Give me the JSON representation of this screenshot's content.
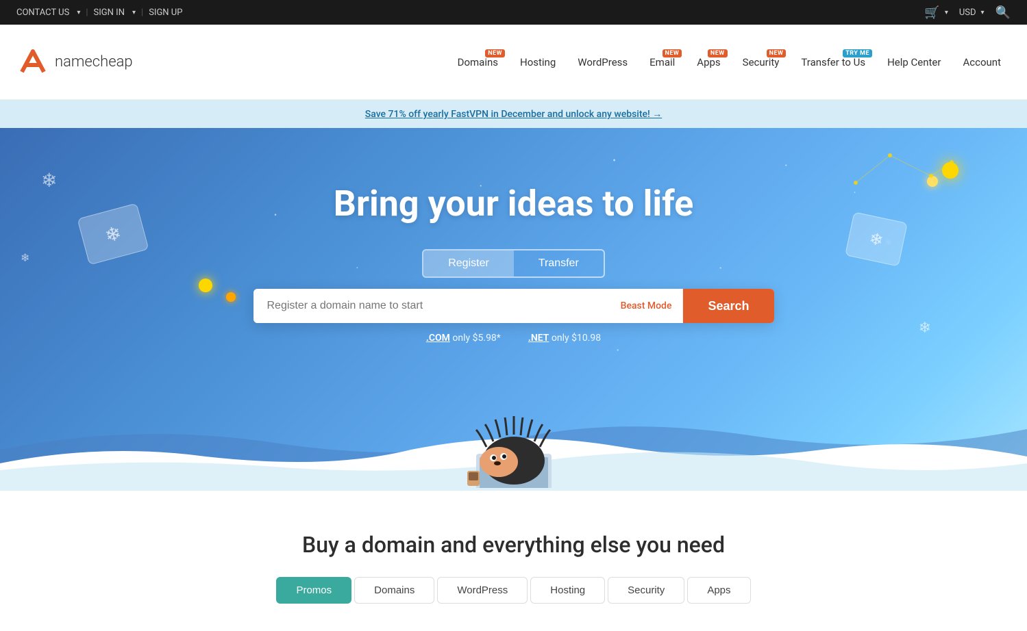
{
  "topbar": {
    "contact_us": "CONTACT US",
    "sign_in": "SIGN IN",
    "sign_up": "SIGN UP",
    "currency": "USD"
  },
  "nav": {
    "logo_text": "namecheap",
    "domains": "Domains",
    "hosting": "Hosting",
    "wordpress": "WordPress",
    "email": "Email",
    "apps": "Apps",
    "security": "Security",
    "transfer": "Transfer to Us",
    "help_center": "Help Center",
    "account": "Account",
    "badge_new": "NEW",
    "badge_tryme": "TRY ME"
  },
  "promo": {
    "text": "Save 71% off yearly FastVPN in December and unlock any website! →"
  },
  "hero": {
    "title": "Bring your ideas to life",
    "tab_register": "Register",
    "tab_transfer": "Transfer",
    "search_placeholder": "Register a domain name to start",
    "beast_mode": "Beast Mode",
    "search_btn": "Search",
    "com_label": ".COM",
    "com_price": "only $5.98*",
    "net_label": ".NET",
    "net_price": "only $10.98"
  },
  "below": {
    "title": "Buy a domain and everything else you need",
    "tabs": [
      "Promos",
      "Domains",
      "WordPress",
      "Hosting",
      "Security",
      "Apps"
    ],
    "active_tab": "Promos"
  }
}
